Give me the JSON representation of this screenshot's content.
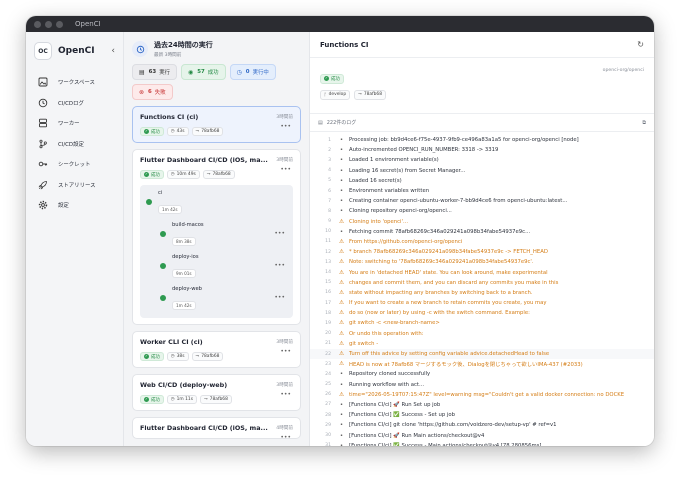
{
  "window": {
    "title": "OpenCI"
  },
  "sidebar": {
    "logo": "OC",
    "app_name": "OpenCI",
    "items": [
      {
        "label": "ワークスペース",
        "icon": "image-icon"
      },
      {
        "label": "CI/CDログ",
        "icon": "history-icon"
      },
      {
        "label": "ワーカー",
        "icon": "server-icon"
      },
      {
        "label": "CI/CD設定",
        "icon": "git-branch-icon"
      },
      {
        "label": "シークレット",
        "icon": "key-icon"
      },
      {
        "label": "ストアリリース",
        "icon": "rocket-icon"
      },
      {
        "label": "設定",
        "icon": "gear-icon"
      }
    ]
  },
  "runs": {
    "title": "過去24時間の実行",
    "subtitle": "最新 3時間前",
    "stats": [
      {
        "value": "63",
        "label": "実行",
        "kind": "all"
      },
      {
        "value": "57",
        "label": "成功",
        "kind": "ok"
      },
      {
        "value": "0",
        "label": "実行中",
        "kind": "run"
      },
      {
        "value": "6",
        "label": "失敗",
        "kind": "fail"
      }
    ],
    "cards": [
      {
        "title": "Functions CI (ci)",
        "time": "3時間前",
        "status": "成功",
        "duration": "43s",
        "commit": "78afb68",
        "selected": true
      },
      {
        "title": "Flutter Dashboard CI/CD (iOS, ma...",
        "time": "3時間前",
        "status": "成功",
        "duration": "10m 49s",
        "commit": "78afb68",
        "jobs": [
          {
            "name": "ci",
            "duration": "1m 42s"
          },
          {
            "name": "build-macos",
            "duration": "8m 38s"
          },
          {
            "name": "deploy-ios",
            "duration": "9m 01s"
          },
          {
            "name": "deploy-web",
            "duration": "1m 42s"
          }
        ]
      },
      {
        "title": "Worker CLI CI (ci)",
        "time": "3時間前",
        "status": "成功",
        "duration": "38s",
        "commit": "78afb68"
      },
      {
        "title": "Web CI/CD (deploy-web)",
        "time": "3時間前",
        "status": "成功",
        "duration": "1m 11s",
        "commit": "78afb68"
      },
      {
        "title": "Flutter Dashboard CI/CD (iOS, ma...",
        "time": "4時間前"
      }
    ]
  },
  "log": {
    "title": "Functions CI",
    "status": "成功",
    "repo": "openci-org/openci",
    "branch": "develop",
    "commit": "78afb68",
    "count_label": "222件のログ",
    "lines": [
      {
        "n": "1",
        "m": "•",
        "t": "Processing job: bb9d4ce6-f75e-4937-9fb9-ce496a83a1a5 for openci-org/openci [node]",
        "k": "info"
      },
      {
        "n": "2",
        "m": "•",
        "t": "Auto-incremented OPENCI_RUN_NUMBER: 3318 -> 3319",
        "k": "info"
      },
      {
        "n": "3",
        "m": "•",
        "t": "Loaded 1 environment variable(s)",
        "k": "info"
      },
      {
        "n": "4",
        "m": "•",
        "t": "Loading 16 secret(s) from Secret Manager...",
        "k": "info"
      },
      {
        "n": "5",
        "m": "•",
        "t": "Loaded 16 secret(s)",
        "k": "info"
      },
      {
        "n": "6",
        "m": "•",
        "t": "Environment variables written",
        "k": "info"
      },
      {
        "n": "7",
        "m": "•",
        "t": "Creating container openci-ubuntu-worker-7-bb9d4ce6 from openci-ubuntu:latest...",
        "k": "info"
      },
      {
        "n": "8",
        "m": "•",
        "t": "Cloning repository openci-org/openci...",
        "k": "info"
      },
      {
        "n": "9",
        "m": "⚠",
        "t": "Cloning into 'openci'...",
        "k": "warn"
      },
      {
        "n": "10",
        "m": "•",
        "t": "Fetching commit 78afb68269c346a029241a098b34fabe54937e9c...",
        "k": "info"
      },
      {
        "n": "11",
        "m": "⚠",
        "t": "From https://github.com/openci-org/openci",
        "k": "warn"
      },
      {
        "n": "12",
        "m": "⚠",
        "t": " * branch            78afb68269c346a029241a098b34fabe54937e9c -> FETCH_HEAD",
        "k": "warn"
      },
      {
        "n": "13",
        "m": "⚠",
        "t": "Note: switching to '78afb68269c346a029241a098b34fabe54937e9c'.",
        "k": "warn"
      },
      {
        "n": "14",
        "m": "⚠",
        "t": "You are in 'detached HEAD' state. You can look around, make experimental",
        "k": "warn"
      },
      {
        "n": "15",
        "m": "⚠",
        "t": "changes and commit them, and you can discard any commits you make in this",
        "k": "warn"
      },
      {
        "n": "16",
        "m": "⚠",
        "t": "state without impacting any branches by switching back to a branch.",
        "k": "warn"
      },
      {
        "n": "17",
        "m": "⚠",
        "t": "If you want to create a new branch to retain commits you create, you may",
        "k": "warn"
      },
      {
        "n": "18",
        "m": "⚠",
        "t": "do so (now or later) by using -c with the switch command. Example:",
        "k": "warn"
      },
      {
        "n": "19",
        "m": "⚠",
        "t": "  git switch -c <new-branch-name>",
        "k": "warn"
      },
      {
        "n": "20",
        "m": "⚠",
        "t": "Or undo this operation with:",
        "k": "warn"
      },
      {
        "n": "21",
        "m": "⚠",
        "t": "  git switch -",
        "k": "warn"
      },
      {
        "n": "22",
        "m": "⚠",
        "t": "Turn off this advice by setting config variable advice.detachedHead to false",
        "k": "warn"
      },
      {
        "n": "23",
        "m": "⚠",
        "t": "HEAD is now at 78afb68 マージするモック後、Dialogを閉じちゃって欲しいIMA-437 (#2033)",
        "k": "warn"
      },
      {
        "n": "24",
        "m": "•",
        "t": "Repository cloned successfully",
        "k": "info"
      },
      {
        "n": "25",
        "m": "•",
        "t": "Running workflow with act...",
        "k": "info"
      },
      {
        "n": "26",
        "m": "⚠",
        "t": "time=\"2026-05-19T07:15:47Z\" level=warning msg=\"Couldn't get a valid docker connection: no DOCKE",
        "k": "warn"
      },
      {
        "n": "27",
        "m": "•",
        "t": "[Functions CI/ci]  🚀  Run Set up job",
        "k": "info"
      },
      {
        "n": "28",
        "m": "•",
        "t": "[Functions CI/ci]   ✅  Success - Set up job",
        "k": "info"
      },
      {
        "n": "29",
        "m": "•",
        "t": "[Functions CI/ci]      git clone 'https://github.com/voidzero-dev/setup-vp' # ref=v1",
        "k": "info"
      },
      {
        "n": "30",
        "m": "•",
        "t": "[Functions CI/ci]  🚀  Run Main actions/checkout@v4",
        "k": "info"
      },
      {
        "n": "31",
        "m": "•",
        "t": "[Functions CI/ci]   ✅  Success - Main actions/checkout@v4 [78.280856ms]",
        "k": "info"
      },
      {
        "n": "32",
        "m": "•",
        "t": "[Functions CI/ci]  🚀  Run Main Set up Vite+",
        "k": "info"
      }
    ]
  },
  "colors": {
    "success": "#2e9a50",
    "warning": "#d47b12",
    "accent": "#2f68c7",
    "danger": "#c93b3b"
  }
}
